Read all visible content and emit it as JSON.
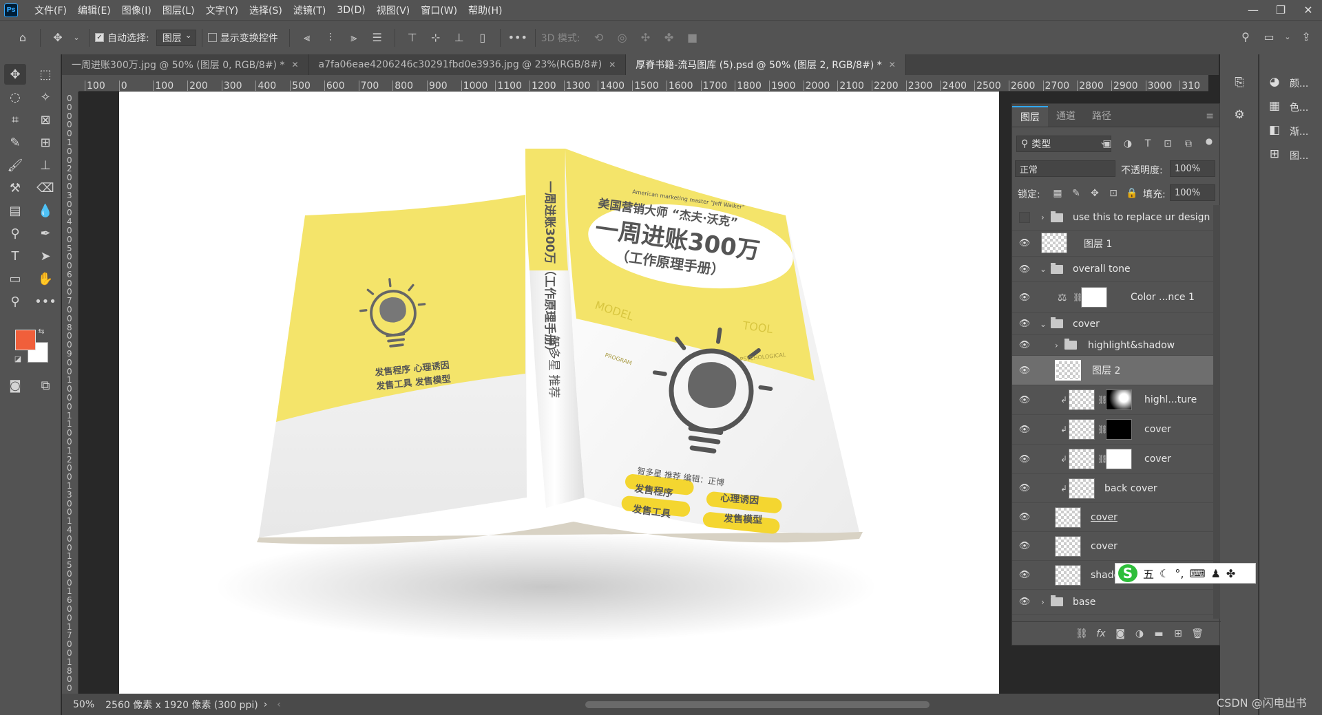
{
  "menu": {
    "logo": "Ps",
    "items": [
      "文件(F)",
      "编辑(E)",
      "图像(I)",
      "图层(L)",
      "文字(Y)",
      "选择(S)",
      "滤镜(T)",
      "3D(D)",
      "视图(V)",
      "窗口(W)",
      "帮助(H)"
    ],
    "window_controls": [
      "—",
      "❐",
      "✕"
    ]
  },
  "options": {
    "auto_select_label": "自动选择:",
    "auto_select_value": "图层",
    "show_transform_label": "显示变换控件",
    "mode_3d_label": "3D 模式:"
  },
  "tabs": [
    {
      "title": "一周进账300万.jpg @ 50% (图层 0, RGB/8#) *",
      "active": false
    },
    {
      "title": "a7fa06eae4206246c30291fbd0e3936.jpg @ 23%(RGB/8#)",
      "active": false
    },
    {
      "title": "厚脊书籍-流马图库 (5).psd @ 50% (图层 2, RGB/8#) *",
      "active": true
    }
  ],
  "ruler_h": [
    "100",
    "0",
    "100",
    "200",
    "300",
    "400",
    "500",
    "600",
    "700",
    "800",
    "900",
    "1000",
    "1100",
    "1200",
    "1300",
    "1400",
    "1500",
    "1600",
    "1700",
    "1800",
    "1900",
    "2000",
    "2100",
    "2200",
    "2300",
    "2400",
    "2500",
    "2600",
    "2700",
    "2800",
    "2900",
    "3000",
    "310"
  ],
  "ruler_v": [
    "0",
    "0",
    "0",
    "0",
    "0",
    "1",
    "0",
    "0",
    "2",
    "0",
    "0",
    "3",
    "0",
    "0",
    "4",
    "0",
    "0",
    "5",
    "0",
    "0",
    "6",
    "0",
    "0",
    "7",
    "0",
    "0",
    "8",
    "0",
    "0",
    "9",
    "0",
    "0",
    "1",
    "0",
    "0",
    "0",
    "1",
    "1",
    "0",
    "0",
    "1",
    "2",
    "0",
    "0",
    "1",
    "3",
    "0",
    "0",
    "1",
    "4",
    "0",
    "0",
    "1",
    "5",
    "0",
    "0",
    "1",
    "6",
    "0",
    "0",
    "1",
    "7",
    "0",
    "0",
    "1",
    "8",
    "0",
    "0"
  ],
  "status": {
    "zoom": "50%",
    "doc_size": "2560 像素 x 1920 像素 (300 ppi)"
  },
  "book": {
    "spine_title": "一周进账300万（工作原理手册）",
    "spine_publisher": "智多星 推荐",
    "front_en_top": "American marketing master \"Jeff Walker\"",
    "front_subtitle": "美国营销大师 “杰夫·沃克”",
    "front_title": "一周进账300万",
    "front_title2": "（工作原理手册）",
    "front_model": "MODEL",
    "front_tool": "TOOL",
    "front_program": "PROGRAM",
    "front_psych": "PSYCHOLOGICAL",
    "front_credit": "智多星 推荐   编辑：正博",
    "front_tags": [
      "发售程序",
      "心理诱因",
      "发售工具",
      "发售模型"
    ],
    "back_line1": "发售程序  心理诱因",
    "back_line2": "发售工具  发售模型",
    "cover_yellow": "#f4e46a"
  },
  "layers_panel": {
    "tabs": [
      "图层",
      "通道",
      "路径"
    ],
    "filter_label": "类型",
    "blend_mode": "正常",
    "opacity_label": "不透明度:",
    "opacity_value": "100%",
    "lock_label": "锁定:",
    "fill_label": "填充:",
    "fill_value": "100%",
    "layers": [
      {
        "name": "use this to replace ur design",
        "kind": "group",
        "visible": false
      },
      {
        "name": "图层 1",
        "kind": "pixel",
        "visible": true
      },
      {
        "name": "overall tone",
        "kind": "group-open",
        "visible": true
      },
      {
        "name": "Color ...nce 1",
        "kind": "adjustment",
        "visible": true
      },
      {
        "name": "cover",
        "kind": "group-open",
        "visible": true
      },
      {
        "name": "highlight&shadow",
        "kind": "group",
        "visible": true
      },
      {
        "name": "图层 2",
        "kind": "smart",
        "visible": true,
        "selected": true
      },
      {
        "name": "highl...ture",
        "kind": "clipped-mask",
        "visible": true
      },
      {
        "name": "cover",
        "kind": "clipped-mask",
        "visible": true
      },
      {
        "name": "cover",
        "kind": "clipped-mask",
        "visible": true
      },
      {
        "name": "back cover",
        "kind": "clipped",
        "visible": true
      },
      {
        "name": "cover",
        "kind": "pixel",
        "visible": true
      },
      {
        "name": "cover",
        "kind": "pixel",
        "visible": true
      },
      {
        "name": "shadow",
        "kind": "pixel",
        "visible": true
      },
      {
        "name": "base",
        "kind": "group",
        "visible": true
      }
    ],
    "bottom_icons": [
      "link-icon",
      "fx-icon",
      "mask-icon",
      "adjustment-icon",
      "group-icon",
      "new-layer-icon",
      "trash-icon"
    ]
  },
  "right_dock": {
    "items": [
      "颜...",
      "色...",
      "渐...",
      "图..."
    ]
  },
  "ime": {
    "logo": "S",
    "mode": "五"
  },
  "watermark": "CSDN @闪电出书"
}
